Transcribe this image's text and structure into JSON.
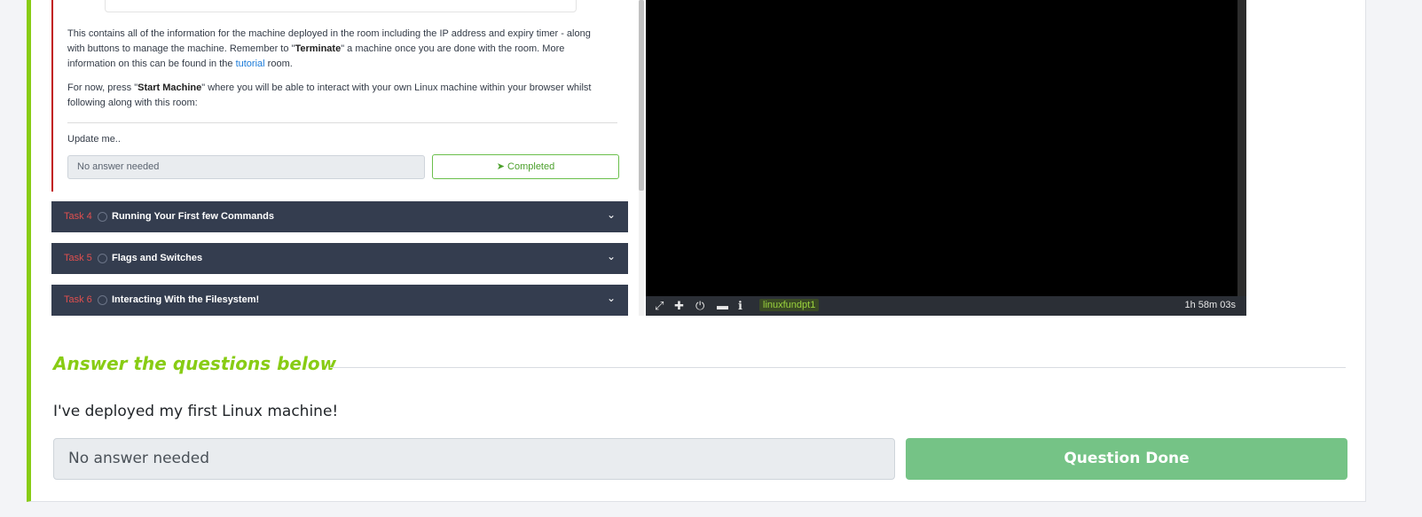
{
  "embedded": {
    "paragraph1_pre": "This contains all of the information for the machine deployed in the room including the IP address and expiry timer - along with buttons to manage the machine. Remember to \"",
    "paragraph1_bold": "Terminate",
    "paragraph1_mid": "\" a machine once you are done with the room. More information on this can be found in the ",
    "paragraph1_link": "tutorial",
    "paragraph1_post": " room.",
    "paragraph2_pre": "For now, press \"",
    "paragraph2_bold": "Start Machine",
    "paragraph2_post": "\" where you will be able to interact with your own Linux machine within your browser whilst following along with this room:",
    "update_label": "Update me..",
    "answer_placeholder": "No answer needed",
    "completed_label": "Completed",
    "tasks": [
      {
        "num": "Task 4",
        "title": "Running Your First few Commands"
      },
      {
        "num": "Task 5",
        "title": "Flags and Switches"
      },
      {
        "num": "Task 6",
        "title": "Interacting With the Filesystem!"
      }
    ],
    "terminal": {
      "machine_name": "linuxfundpt1",
      "timer": "1h 58m 03s"
    }
  },
  "questions": {
    "heading": "Answer the questions below",
    "question_text": "I've deployed my first Linux machine!",
    "answer_placeholder": "No answer needed",
    "submit_label": "Question Done"
  },
  "colors": {
    "accent": "#88cc14",
    "task_bar": "#343d4f",
    "task_number": "#e04f4f",
    "done_button": "#75c386"
  }
}
